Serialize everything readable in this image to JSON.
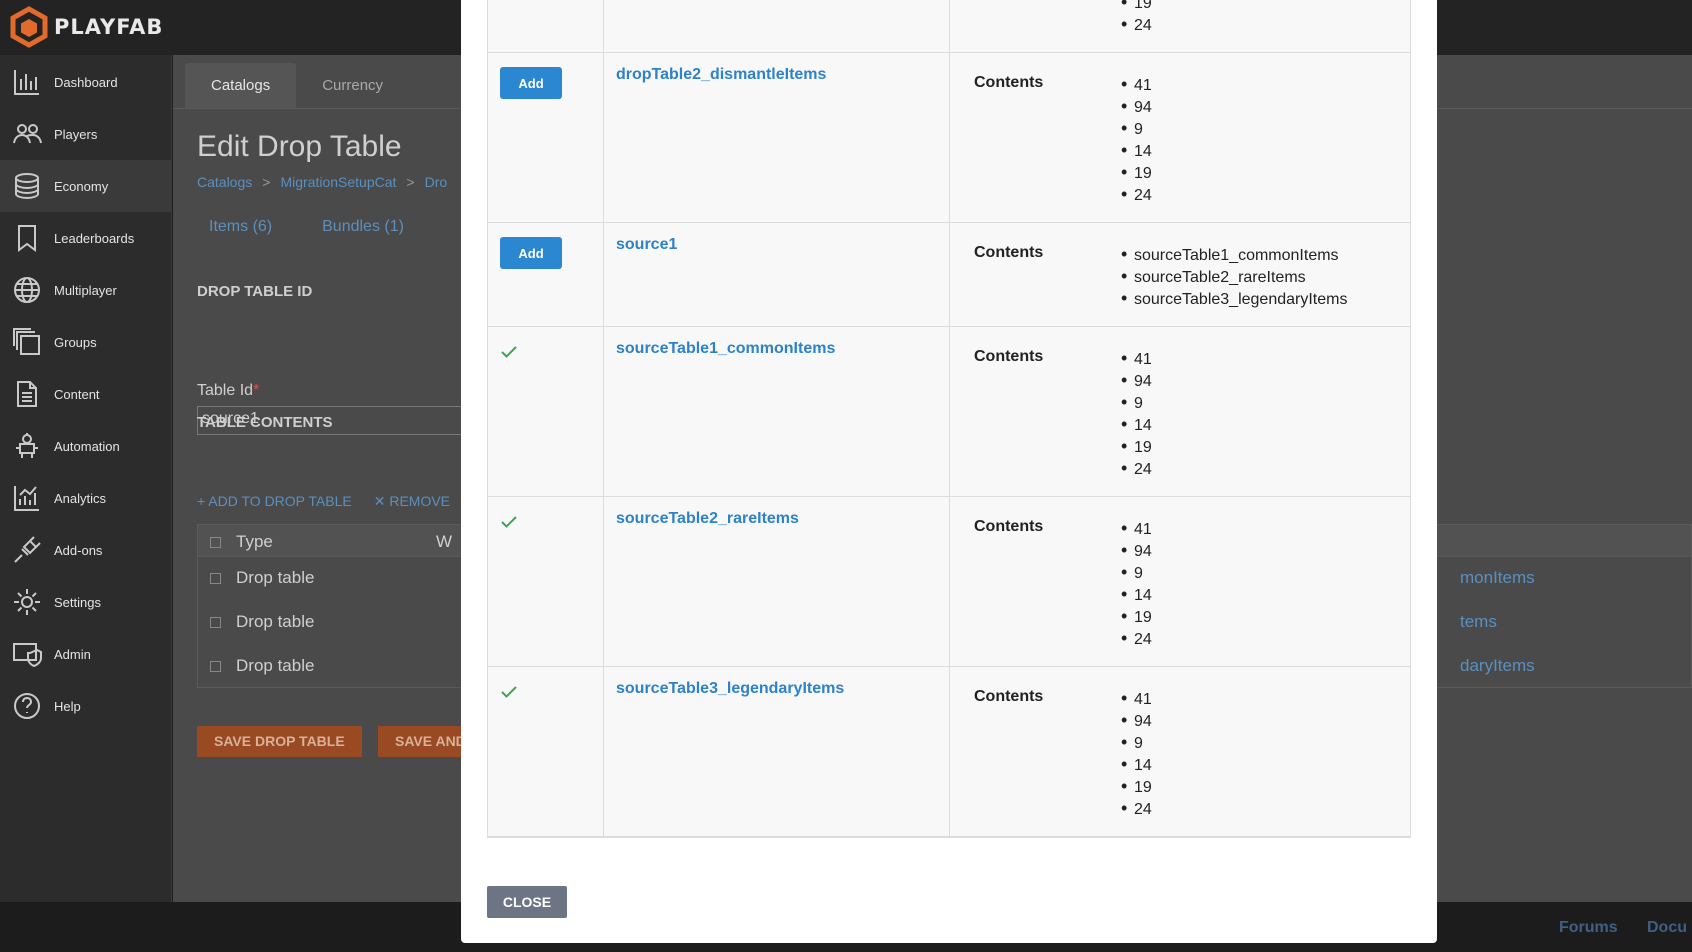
{
  "app": {
    "brand": "PLAYFAB"
  },
  "sidebar": {
    "items": [
      {
        "label": "Dashboard",
        "icon": "bar-chart-icon"
      },
      {
        "label": "Players",
        "icon": "players-icon"
      },
      {
        "label": "Economy",
        "icon": "database-icon",
        "active": true
      },
      {
        "label": "Leaderboards",
        "icon": "bookmark-icon"
      },
      {
        "label": "Multiplayer",
        "icon": "globe-icon"
      },
      {
        "label": "Groups",
        "icon": "groups-icon"
      },
      {
        "label": "Content",
        "icon": "document-icon"
      },
      {
        "label": "Automation",
        "icon": "robot-icon"
      },
      {
        "label": "Analytics",
        "icon": "analytics-icon"
      },
      {
        "label": "Add-ons",
        "icon": "plug-icon"
      },
      {
        "label": "Settings",
        "icon": "gear-icon"
      },
      {
        "label": "Admin",
        "icon": "admin-icon"
      },
      {
        "label": "Help",
        "icon": "help-icon"
      }
    ]
  },
  "main": {
    "tabs": [
      {
        "label": "Catalogs"
      },
      {
        "label": "Currency"
      }
    ],
    "page_title": "Edit Drop Table",
    "breadcrumb": [
      "Catalogs",
      "MigrationSetupCat",
      "Dro"
    ],
    "subtabs": [
      "Items (6)",
      "Bundles (1)"
    ],
    "drop_table_id_heading": "DROP TABLE ID",
    "table_id_label": "Table Id",
    "table_id_required": "*",
    "table_id_value": "source1",
    "table_contents_heading": "TABLE CONTENTS",
    "actions": {
      "add": "+ ADD TO DROP TABLE",
      "remove": "✕ REMOVE"
    },
    "contents_table": {
      "header_type": "Type",
      "header_partial": "W",
      "rows": [
        {
          "type": "Drop table",
          "right": "monItems"
        },
        {
          "type": "Drop table",
          "right": "tems"
        },
        {
          "type": "Drop table",
          "right": "daryItems"
        }
      ]
    },
    "save_button": "SAVE DROP TABLE",
    "save_and_button": "SAVE AND"
  },
  "footer": {
    "links": [
      "Forums",
      "Docu"
    ]
  },
  "modal": {
    "partial_row": {
      "items": [
        "19",
        "24"
      ]
    },
    "rows": [
      {
        "name": "dropTable2_dismantleItems",
        "status": "add",
        "contents_label": "Contents",
        "items": [
          "41",
          "94",
          "9",
          "14",
          "19",
          "24"
        ]
      },
      {
        "name": "source1",
        "status": "add",
        "contents_label": "Contents",
        "items": [
          "sourceTable1_commonItems",
          "sourceTable2_rareItems",
          "sourceTable3_legendaryItems"
        ]
      },
      {
        "name": "sourceTable1_commonItems",
        "status": "added",
        "contents_label": "Contents",
        "items": [
          "41",
          "94",
          "9",
          "14",
          "19",
          "24"
        ]
      },
      {
        "name": "sourceTable2_rareItems",
        "status": "added",
        "contents_label": "Contents",
        "items": [
          "41",
          "94",
          "9",
          "14",
          "19",
          "24"
        ]
      },
      {
        "name": "sourceTable3_legendaryItems",
        "status": "added",
        "contents_label": "Contents",
        "items": [
          "41",
          "94",
          "9",
          "14",
          "19",
          "24"
        ]
      }
    ],
    "add_label": "Add",
    "close_label": "CLOSE"
  }
}
